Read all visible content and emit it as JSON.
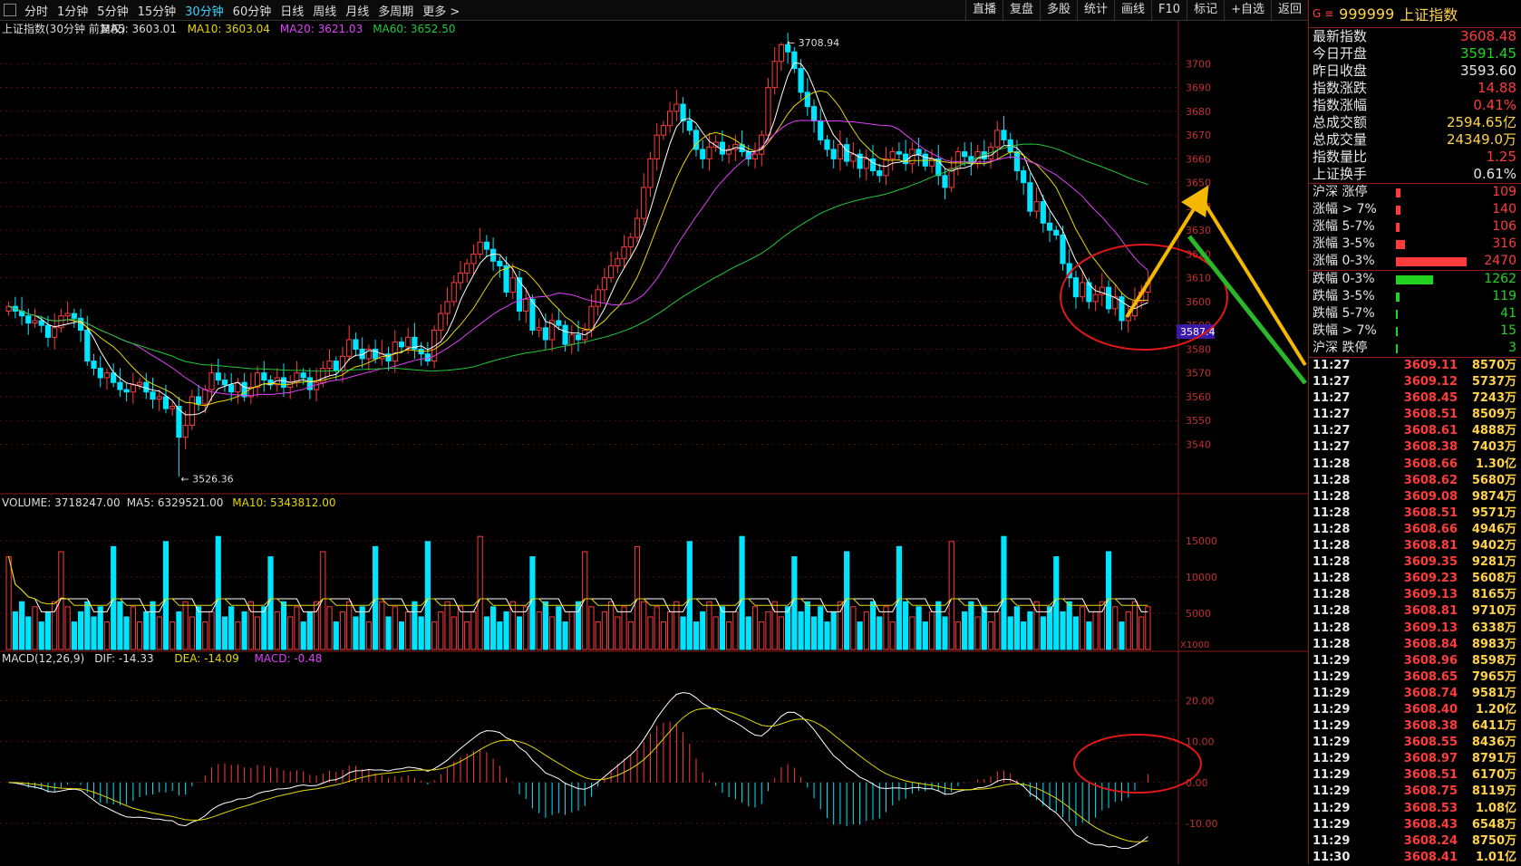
{
  "toolbar": {
    "tabs": [
      "分时",
      "1分钟",
      "5分钟",
      "15分钟",
      "30分钟",
      "60分钟",
      "日线",
      "周线",
      "月线",
      "多周期",
      "更多 >"
    ],
    "active_tab": "30分钟",
    "right_buttons": [
      "直播",
      "复盘",
      "多股",
      "统计",
      "画线",
      "F10",
      "标记",
      "+自选",
      "返回"
    ]
  },
  "legend": {
    "price": {
      "title": "上证指数(30分钟 前复权)",
      "ma5": "MA5: 3603.01",
      "ma10": "MA10: 3603.04",
      "ma20": "MA20: 3621.03",
      "ma60": "MA60: 3652.50"
    },
    "volume": {
      "title": "VOLUME: 3718247.00",
      "ma5": "MA5: 6329521.00",
      "ma10": "MA10: 5343812.00"
    },
    "macd": {
      "title": "MACD(12,26,9)",
      "dif": "DIF: -14.33",
      "dea": "DEA: -14.09",
      "macd": "MACD: -0.48"
    }
  },
  "annotations": {
    "high": "3708.94",
    "low": "3526.36",
    "price_marker": "3587.4",
    "vol_unit": "X1000"
  },
  "colors": {
    "up": "#ff3b3b",
    "down": "#00e5ff",
    "ma5": "#ffffff",
    "ma10": "#e5d800",
    "ma20": "#e040fb",
    "ma60": "#22c83a",
    "grid": "#5a0f0f",
    "arrow_yellow": "#f5b800",
    "arrow_green": "#29b829",
    "circle": "#e01818"
  },
  "chart_data": [
    {
      "type": "candlestick",
      "title": "上证指数(30分钟 前复权)",
      "yaxis_ticks": [
        3540,
        3550,
        3560,
        3570,
        3580,
        3590,
        3600,
        3610,
        3620,
        3630,
        3640,
        3650,
        3660,
        3670,
        3680,
        3690,
        3700
      ],
      "ylim": [
        3520,
        3715
      ],
      "closes": [
        3598,
        3596,
        3594,
        3591,
        3592,
        3590,
        3585,
        3589,
        3594,
        3595,
        3593,
        3588,
        3575,
        3572,
        3568,
        3570,
        3566,
        3563,
        3562,
        3565,
        3566,
        3562,
        3559,
        3560,
        3555,
        3556,
        3543,
        3548,
        3560,
        3557,
        3563,
        3570,
        3567,
        3565,
        3562,
        3566,
        3560,
        3564,
        3570,
        3567,
        3565,
        3568,
        3564,
        3566,
        3570,
        3568,
        3563,
        3566,
        3572,
        3575,
        3571,
        3577,
        3584,
        3580,
        3576,
        3580,
        3576,
        3578,
        3575,
        3583,
        3581,
        3585,
        3580,
        3578,
        3575,
        3588,
        3595,
        3600,
        3608,
        3612,
        3616,
        3620,
        3625,
        3622,
        3617,
        3615,
        3604,
        3610,
        3596,
        3601,
        3588,
        3589,
        3584,
        3592,
        3590,
        3582,
        3586,
        3584,
        3588,
        3598,
        3605,
        3610,
        3615,
        3618,
        3623,
        3627,
        3635,
        3648,
        3660,
        3670,
        3674,
        3680,
        3683,
        3676,
        3672,
        3664,
        3660,
        3665,
        3667,
        3662,
        3664,
        3666,
        3663,
        3660,
        3662,
        3670,
        3690,
        3701,
        3708,
        3705,
        3698,
        3688,
        3682,
        3676,
        3668,
        3664,
        3660,
        3666,
        3659,
        3662,
        3656,
        3660,
        3655,
        3653,
        3660,
        3663,
        3662,
        3658,
        3664,
        3662,
        3657,
        3660,
        3653,
        3648,
        3656,
        3663,
        3661,
        3658,
        3663,
        3660,
        3665,
        3672,
        3668,
        3663,
        3655,
        3650,
        3638,
        3642,
        3633,
        3630,
        3628,
        3616,
        3610,
        3602,
        3608,
        3600,
        3603,
        3606,
        3597,
        3602,
        3592,
        3594,
        3600,
        3604,
        3608
      ],
      "high": 3708.94,
      "low": 3526.36,
      "ma5": 3603.01,
      "ma10": 3603.04,
      "ma20": 3621.03,
      "ma60": 3652.5
    },
    {
      "type": "bar",
      "title": "VOLUME",
      "yaxis_ticks": [
        5000,
        10000,
        15000
      ],
      "unit": "X1000"
    },
    {
      "type": "bar",
      "title": "MACD(12,26,9)",
      "yaxis_ticks": [
        -10.0,
        0.0,
        10.0,
        20.0
      ],
      "dif": -14.33,
      "dea": -14.09,
      "macd": -0.48
    }
  ],
  "panel": {
    "symbol_prefix": "G ≡",
    "code": "999999",
    "name": "上证指数",
    "quote": [
      {
        "label": "最新指数",
        "value": "3608.48",
        "color": "#ff3b3b"
      },
      {
        "label": "今日开盘",
        "value": "3591.45",
        "color": "#22d422"
      },
      {
        "label": "昨日收盘",
        "value": "3593.60",
        "color": "#e6e6e6"
      },
      {
        "label": "指数涨跌",
        "value": "14.88",
        "color": "#ff3b3b"
      },
      {
        "label": "指数涨幅",
        "value": "0.41%",
        "color": "#ff3b3b"
      },
      {
        "label": "总成交额",
        "value": "2594.65亿",
        "color": "#ffd24a"
      },
      {
        "label": "总成交量",
        "value": "24349.0万",
        "color": "#ffd24a"
      },
      {
        "label": "指数量比",
        "value": "1.25",
        "color": "#ff3b3b"
      },
      {
        "label": "上证换手",
        "value": "0.61%",
        "color": "#e6e6e6"
      }
    ],
    "breadth_up": [
      {
        "label": "沪深 涨停",
        "value": "109",
        "bar": 0.06
      },
      {
        "label": "涨幅 > 7%",
        "value": "140",
        "bar": 0.06
      },
      {
        "label": "涨幅 5-7%",
        "value": "106",
        "bar": 0.05
      },
      {
        "label": "涨幅 3-5%",
        "value": "316",
        "bar": 0.13
      },
      {
        "label": "涨幅 0-3%",
        "value": "2470",
        "bar": 1.0
      }
    ],
    "breadth_down": [
      {
        "label": "跌幅 0-3%",
        "value": "1262",
        "bar": 0.52
      },
      {
        "label": "跌幅 3-5%",
        "value": "119",
        "bar": 0.05
      },
      {
        "label": "跌幅 5-7%",
        "value": "41",
        "bar": 0.02
      },
      {
        "label": "跌幅 > 7%",
        "value": "15",
        "bar": 0.01
      },
      {
        "label": "沪深 跌停",
        "value": "3",
        "bar": 0.01
      }
    ],
    "ticks": [
      [
        "11:27",
        "3609.11",
        "8570万"
      ],
      [
        "11:27",
        "3609.12",
        "5737万"
      ],
      [
        "11:27",
        "3608.45",
        "7243万"
      ],
      [
        "11:27",
        "3608.51",
        "8509万"
      ],
      [
        "11:27",
        "3608.61",
        "4888万"
      ],
      [
        "11:27",
        "3608.38",
        "7403万"
      ],
      [
        "11:28",
        "3608.66",
        "1.30亿"
      ],
      [
        "11:28",
        "3608.62",
        "5680万"
      ],
      [
        "11:28",
        "3609.08",
        "9874万"
      ],
      [
        "11:28",
        "3608.51",
        "9571万"
      ],
      [
        "11:28",
        "3608.66",
        "4946万"
      ],
      [
        "11:28",
        "3608.81",
        "9402万"
      ],
      [
        "11:28",
        "3609.35",
        "9281万"
      ],
      [
        "11:28",
        "3609.23",
        "5608万"
      ],
      [
        "11:28",
        "3609.13",
        "8165万"
      ],
      [
        "11:28",
        "3608.81",
        "9710万"
      ],
      [
        "11:28",
        "3609.13",
        "6338万"
      ],
      [
        "11:28",
        "3608.84",
        "8983万"
      ],
      [
        "11:29",
        "3608.96",
        "8598万"
      ],
      [
        "11:29",
        "3608.65",
        "7965万"
      ],
      [
        "11:29",
        "3608.74",
        "9581万"
      ],
      [
        "11:29",
        "3608.40",
        "1.20亿"
      ],
      [
        "11:29",
        "3608.38",
        "6411万"
      ],
      [
        "11:29",
        "3608.55",
        "8436万"
      ],
      [
        "11:29",
        "3608.97",
        "8791万"
      ],
      [
        "11:29",
        "3608.51",
        "6170万"
      ],
      [
        "11:29",
        "3608.75",
        "8119万"
      ],
      [
        "11:29",
        "3608.53",
        "1.08亿"
      ],
      [
        "11:29",
        "3608.43",
        "6548万"
      ],
      [
        "11:29",
        "3608.24",
        "8750万"
      ],
      [
        "11:30",
        "3608.41",
        "1.01亿"
      ]
    ]
  }
}
